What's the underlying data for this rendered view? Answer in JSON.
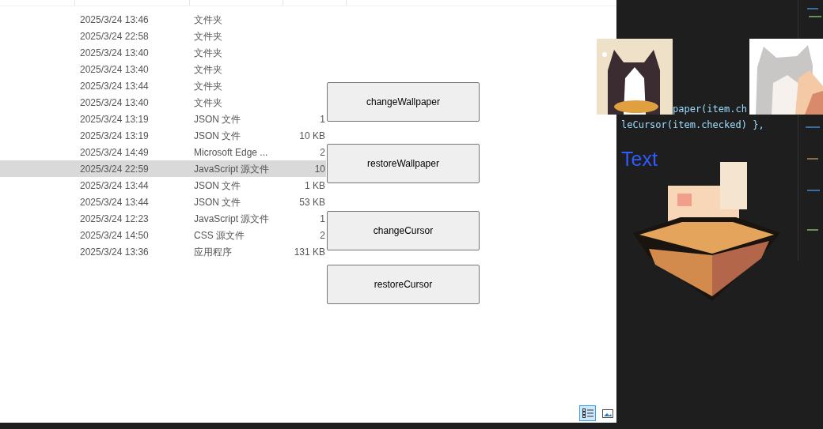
{
  "file_list": {
    "rows": [
      {
        "date": "2025/3/24 13:46",
        "type": "文件夹",
        "selected": false
      },
      {
        "date": "2025/3/24 22:58",
        "type": "文件夹",
        "selected": false
      },
      {
        "date": "2025/3/24 13:40",
        "type": "文件夹",
        "selected": false
      },
      {
        "date": "2025/3/24 13:40",
        "type": "文件夹",
        "selected": false
      },
      {
        "date": "2025/3/24 13:44",
        "type": "文件夹",
        "selected": false
      },
      {
        "date": "2025/3/24 13:40",
        "type": "文件夹",
        "selected": false
      },
      {
        "date": "2025/3/24 13:19",
        "type": "JSON 文件",
        "size": "1",
        "selected": false
      },
      {
        "date": "2025/3/24 13:19",
        "type": "JSON 文件",
        "size": "10 KB",
        "selected": false
      },
      {
        "date": "2025/3/24 14:49",
        "type": "Microsoft Edge ...",
        "size": "2",
        "selected": false
      },
      {
        "date": "2025/3/24 22:59",
        "type": "JavaScript 源文件",
        "size": "10",
        "selected": true
      },
      {
        "date": "2025/3/24 13:44",
        "type": "JSON 文件",
        "size": "1 KB",
        "selected": false
      },
      {
        "date": "2025/3/24 13:44",
        "type": "JSON 文件",
        "size": "53 KB",
        "selected": false
      },
      {
        "date": "2025/3/24 12:23",
        "type": "JavaScript 源文件",
        "size": "1",
        "selected": false
      },
      {
        "date": "2025/3/24 14:50",
        "type": "CSS 源文件",
        "size": "2",
        "selected": false
      },
      {
        "date": "2025/3/24 13:36",
        "type": "应用程序",
        "size": "131 KB",
        "selected": false
      }
    ],
    "view_buttons": [
      {
        "selected": true
      },
      {
        "selected": false
      }
    ]
  },
  "buttons": [
    "changeWallpaper",
    "restoreWallpaper",
    "changeCursor",
    "restoreCursor"
  ],
  "editor": {
    "code_lines": [
      "paper(item.ch",
      "leCursor(item.checked) },"
    ],
    "label": "Text"
  }
}
